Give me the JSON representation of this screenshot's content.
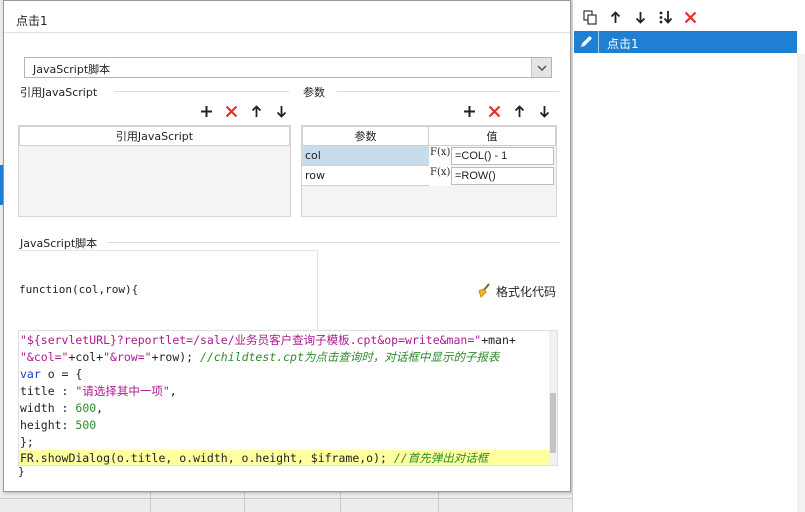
{
  "dialog": {
    "title": "点击1",
    "script_type": "JavaScript脚本",
    "ref_section_label": "引用JavaScript",
    "ref_table_header": "引用JavaScript",
    "params_section_label": "参数",
    "params_headers": [
      "参数",
      "值"
    ],
    "params": [
      {
        "name": "col",
        "fx": "F(x)",
        "value": "=COL() - 1"
      },
      {
        "name": "row",
        "fx": "F(x)",
        "value": "=ROW()"
      }
    ],
    "script_section_label": "JavaScript脚本",
    "function_signature": "function(col,row){",
    "format_button": "格式化代码",
    "code_lines": {
      "l1_str": "\"${servletURL}?reportlet=/sale/业务员客户查询子模板.cpt&op=write&man=\"",
      "l1_rest": "+man+",
      "l2_str1": "\"&col=\"",
      "l2_mid1": "+col+",
      "l2_str2": "\"&row=\"",
      "l2_mid2": "+row); ",
      "l2_cm": "//childtest.cpt为点击查询时，对话框中显示的子报表",
      "l3_kw": "var",
      "l3_rest": " o = {",
      "l4_key": "title : ",
      "l4_str": "\"请选择其中一项\"",
      "l4_end": ",",
      "l5_key": "width : ",
      "l5_num": "600",
      "l5_end": ",",
      "l6_key": "height: ",
      "l6_num": "500",
      "l7": "};",
      "l8_code": "FR.showDialog(o.title, o.width, o.height, $iframe,o); ",
      "l8_cm": "//首先弹出对话框"
    },
    "closing_brace": "}"
  },
  "right_panel": {
    "items": [
      {
        "label": "点击1"
      }
    ]
  },
  "colors": {
    "selection": "#1f7fd3",
    "delete_red": "#e0312c",
    "highlight_line": "#ffffa0",
    "param_selected": "#c9dcec"
  }
}
